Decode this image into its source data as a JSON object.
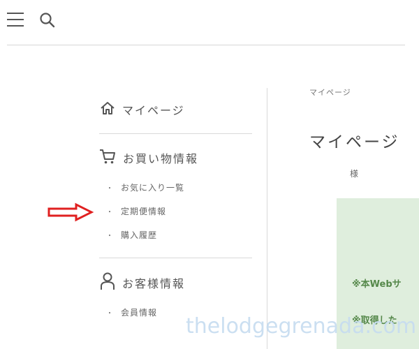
{
  "header": {
    "menu_icon": "hamburger-menu-icon",
    "search_icon": "search-icon"
  },
  "sidebar": {
    "mypage": {
      "icon": "home-icon",
      "label": "マイページ"
    },
    "shopping": {
      "icon": "shopping-cart-icon",
      "label": "お買い物情報",
      "items": [
        "お気に入り一覧",
        "定期便情報",
        "購入履歴"
      ]
    },
    "customer": {
      "icon": "person-icon",
      "label": "お客様情報",
      "items": [
        "会員情報"
      ]
    }
  },
  "main": {
    "breadcrumb": "マイページ",
    "title": "マイページ",
    "honorific": "様",
    "notice": {
      "line1": "※本Webサ",
      "line2": "※取得した",
      "background": "#dfeedd",
      "text_color": "#55884a"
    }
  },
  "annotation": {
    "arrow_color": "#e02020"
  },
  "watermark": "thelodgegrenada.com"
}
